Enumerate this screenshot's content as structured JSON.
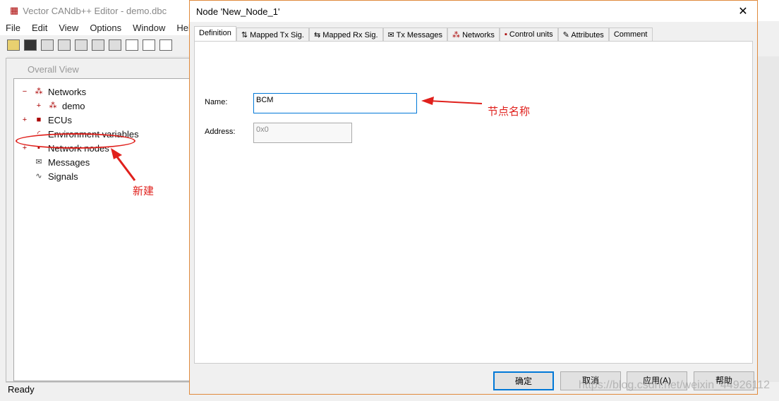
{
  "app": {
    "title": "Vector CANdb++ Editor - demo.dbc",
    "menu": [
      "File",
      "Edit",
      "View",
      "Options",
      "Window",
      "Help"
    ],
    "status": "Ready"
  },
  "overall": {
    "title": "Overall View",
    "tree": [
      {
        "label": "Networks",
        "icon": "network-icon",
        "expander": "−"
      },
      {
        "label": "demo",
        "icon": "network-icon",
        "expander": "+"
      },
      {
        "label": "ECUs",
        "icon": "ecu-icon",
        "expander": "+"
      },
      {
        "label": "Environment variables",
        "icon": "gauge-icon",
        "expander": ""
      },
      {
        "label": "Network nodes",
        "icon": "node-icon",
        "expander": "+"
      },
      {
        "label": "Messages",
        "icon": "envelope-icon",
        "expander": ""
      },
      {
        "label": "Signals",
        "icon": "wave-icon",
        "expander": ""
      }
    ]
  },
  "dialog": {
    "title": "Node 'New_Node_1'",
    "tabs": [
      "Definition",
      "Mapped Tx Sig.",
      "Mapped Rx Sig.",
      "Tx Messages",
      "Networks",
      "Control units",
      "Attributes",
      "Comment"
    ],
    "name_label": "Name:",
    "name_value": "BCM",
    "address_label": "Address:",
    "address_value": "0x0",
    "buttons": {
      "ok": "确定",
      "cancel": "取消",
      "apply": "应用(A)",
      "help": "帮助"
    }
  },
  "annotations": {
    "node_name": "节点名称",
    "new": "新建",
    "color": "#e0201c"
  },
  "watermark": "https://blog.csdn.net/weixin_44926112"
}
